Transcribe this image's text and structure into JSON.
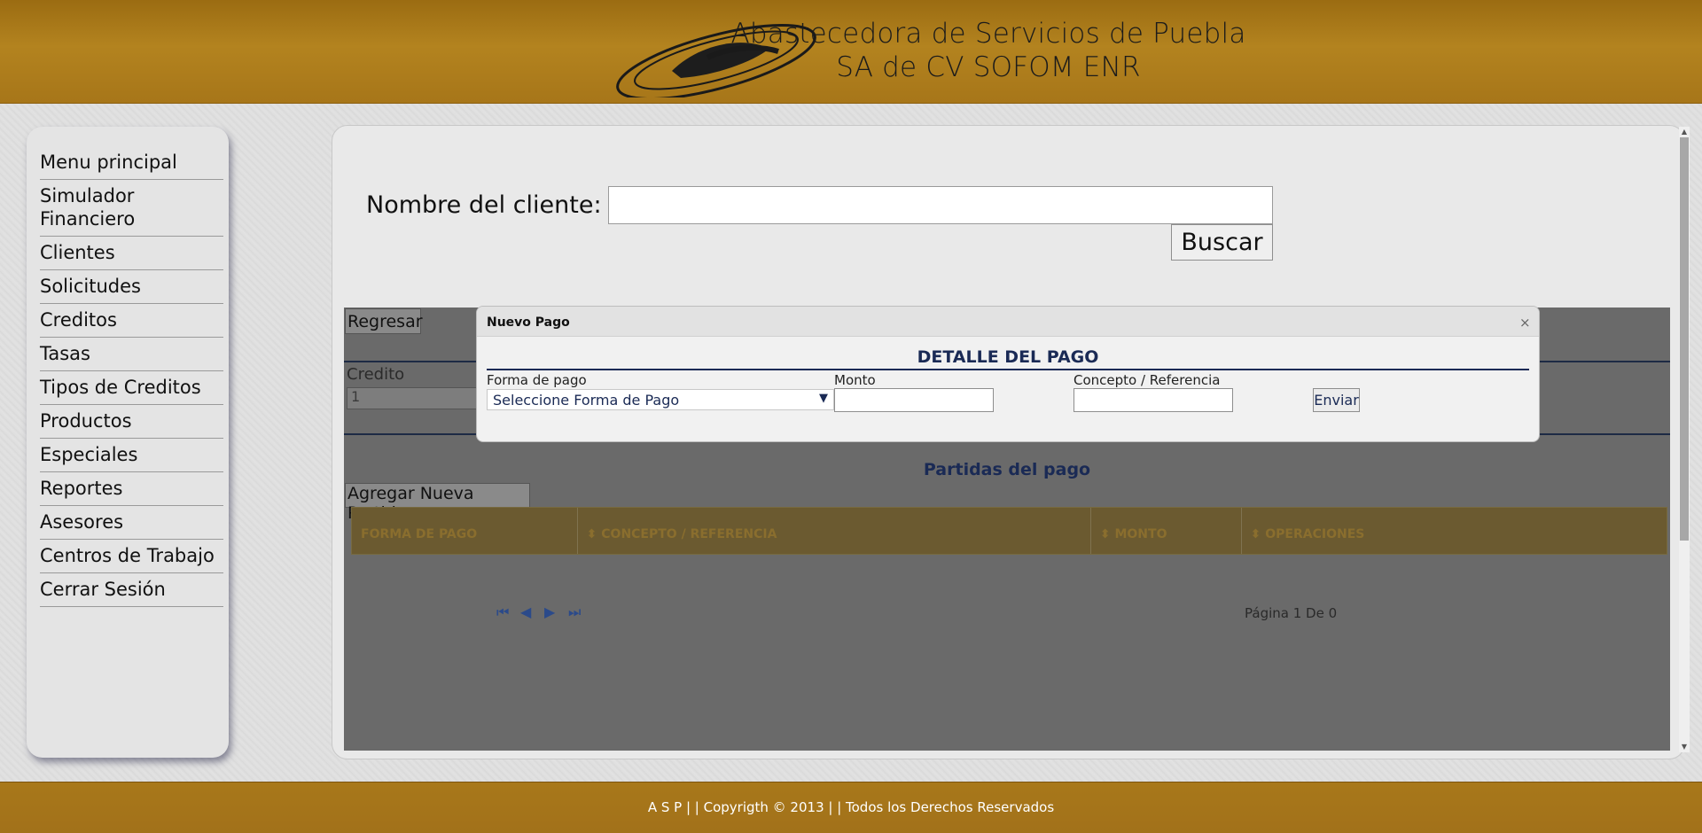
{
  "header": {
    "title_line1": "Abastecedora de Servicios de Puebla",
    "title_line2": "SA de CV SOFOM ENR",
    "logo_icon": "swirl-logo-icon"
  },
  "sidebar": {
    "items": [
      {
        "label": "Menu principal"
      },
      {
        "label": "Simulador Financiero"
      },
      {
        "label": "Clientes"
      },
      {
        "label": "Solicitudes"
      },
      {
        "label": "Creditos"
      },
      {
        "label": "Tasas"
      },
      {
        "label": "Tipos de Creditos"
      },
      {
        "label": "Productos"
      },
      {
        "label": "Especiales"
      },
      {
        "label": "Reportes"
      },
      {
        "label": "Asesores"
      },
      {
        "label": "Centros de Trabajo"
      },
      {
        "label": "Cerrar Sesión"
      }
    ]
  },
  "search": {
    "label": "Nombre del cliente:",
    "value": "",
    "button": "Buscar"
  },
  "content": {
    "back_button": "Regresar",
    "credito_label": "Credito",
    "credito_value": "1",
    "partidas_title": "Partidas del pago",
    "add_button": "Agregar Nueva Partida",
    "grid_columns": [
      "FORMA DE PAGO",
      "CONCEPTO / REFERENCIA",
      "MONTO",
      "OPERACIONES"
    ],
    "pager_text": "Página 1 De 0"
  },
  "modal": {
    "title": "Nuevo Pago",
    "close": "×",
    "section_title": "DETALLE DEL PAGO",
    "forma_label": "Forma de pago",
    "forma_selected": "Seleccione Forma de Pago",
    "monto_label": "Monto",
    "monto_value": "",
    "concepto_label": "Concepto / Referencia",
    "concepto_value": "",
    "submit": "Enviar"
  },
  "footer": {
    "text": "A S P | | Copyrigth © 2013 | | Todos los Derechos Reservados"
  },
  "colors": {
    "header_gold": "#b3831f",
    "accent_navy": "#1a2a55"
  }
}
